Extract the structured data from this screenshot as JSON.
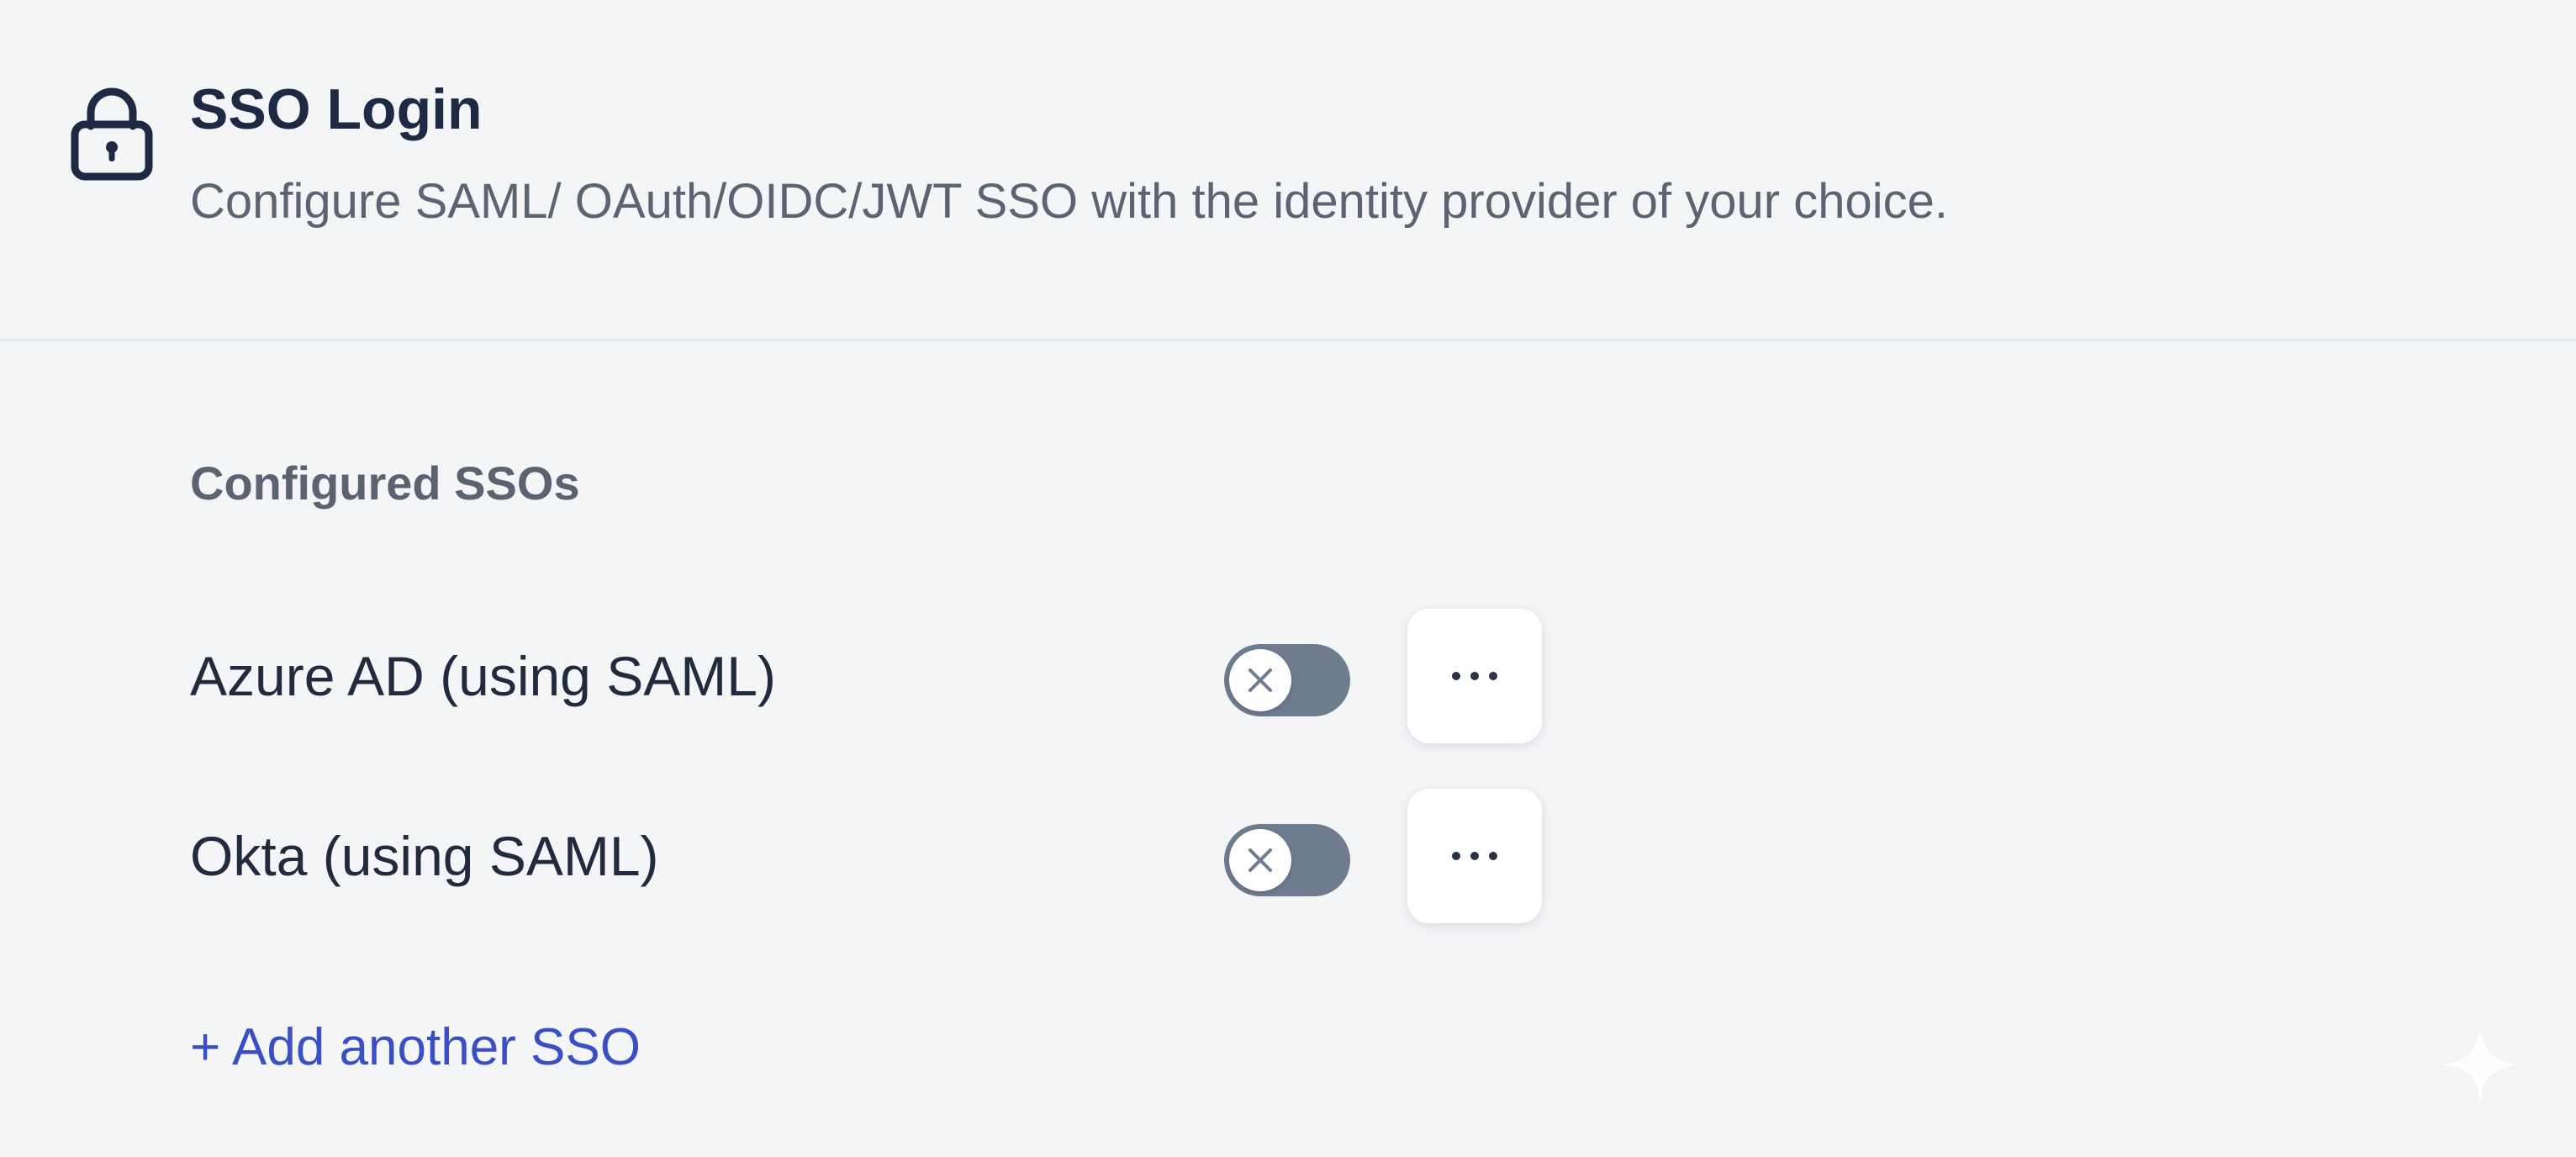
{
  "header": {
    "icon": "lock-icon",
    "title": "SSO Login",
    "subtitle": "Configure SAML/ OAuth/OIDC/JWT SSO with the identity provider of your choice."
  },
  "configured": {
    "heading": "Configured SSOs",
    "items": [
      {
        "label": "Azure AD (using SAML)",
        "enabled": false,
        "toggle_icon": "x-icon",
        "menu_icon": "ellipsis-icon"
      },
      {
        "label": "Okta (using SAML)",
        "enabled": false,
        "toggle_icon": "x-icon",
        "menu_icon": "ellipsis-icon"
      }
    ],
    "add_label": "+ Add another SSO"
  },
  "colors": {
    "background": "#f4f5f7",
    "title": "#1e2a44",
    "toggle_off": "#6f7b8f",
    "link": "#3a4fc4"
  }
}
